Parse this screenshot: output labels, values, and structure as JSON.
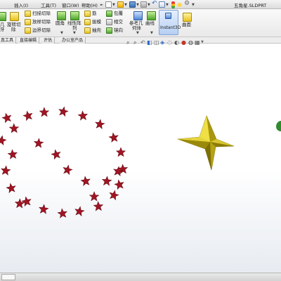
{
  "menubar": {
    "items": [
      "插入(I)",
      "工具(T)",
      "窗口(W)",
      "帮助(H)"
    ],
    "document_title": "五角星.SLDPRT"
  },
  "ribbon": {
    "left_cut": {
      "label1": "几",
      "label2": "牙"
    },
    "revolve_cut": {
      "label1": "旋转切",
      "label2": "除"
    },
    "cut_group": [
      "扫描切除",
      "放样切除",
      "边界切除"
    ],
    "fillet": "圆角",
    "linear_pattern": {
      "label1": "线性阵",
      "label2": "列"
    },
    "features_col1": [
      "筋",
      "拔模",
      "抽壳"
    ],
    "features_col2": [
      "包覆",
      "相交",
      "镜向"
    ],
    "ref_geometry": {
      "label1": "参考几",
      "label2": "何体"
    },
    "curves": "曲线",
    "instant3d": "Instant3D",
    "surface": "曲面"
  },
  "tabs": [
    "真工具",
    "直接编辑",
    "评估",
    "办公室产品"
  ],
  "scene": {
    "small_star_color": "#a01523",
    "large_star_color": "#c8b21a",
    "green_object_color": "#2e8b2e"
  }
}
